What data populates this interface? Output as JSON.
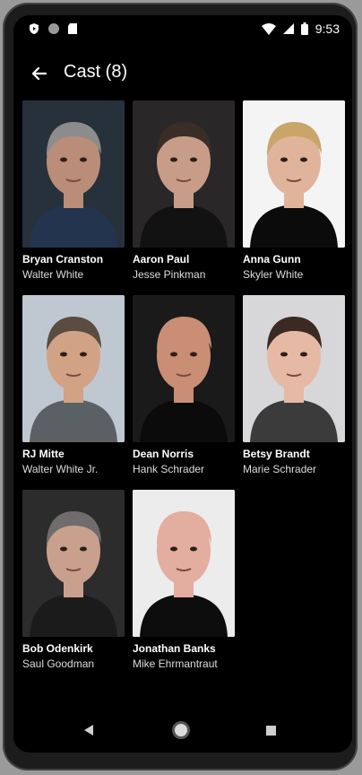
{
  "status": {
    "time": "9:53"
  },
  "appbar": {
    "title": "Cast (8)"
  },
  "cast": [
    {
      "name": "Bryan Cranston",
      "role": "Walter White",
      "bg": "#26313b",
      "skin": "#b98d77",
      "hair": "#8c8c8c",
      "shirt": "#23344f"
    },
    {
      "name": "Aaron Paul",
      "role": "Jesse Pinkman",
      "bg": "#2a2729",
      "skin": "#c79d89",
      "hair": "#3a2d26",
      "shirt": "#121212"
    },
    {
      "name": "Anna Gunn",
      "role": "Skyler White",
      "bg": "#f4f4f4",
      "skin": "#e0b49b",
      "hair": "#c9a56a",
      "shirt": "#0b0b0b"
    },
    {
      "name": "RJ Mitte",
      "role": "Walter White Jr.",
      "bg": "#bfc8d1",
      "skin": "#d2a285",
      "hair": "#5a4c40",
      "shirt": "#5b6065"
    },
    {
      "name": "Dean Norris",
      "role": "Hank Schrader",
      "bg": "#1a1a1a",
      "skin": "#c98e74",
      "hair": "#c98e74",
      "shirt": "#0b0b0b"
    },
    {
      "name": "Betsy Brandt",
      "role": "Marie Schrader",
      "bg": "#d7d7da",
      "skin": "#e6b9a5",
      "hair": "#3b2a22",
      "shirt": "#3b3b3b"
    },
    {
      "name": "Bob Odenkirk",
      "role": "Saul Goodman",
      "bg": "#2c2c2c",
      "skin": "#c9a08e",
      "hair": "#6f6c6b",
      "shirt": "#1b1b1b"
    },
    {
      "name": "Jonathan Banks",
      "role": "Mike Ehrmantraut",
      "bg": "#ececec",
      "skin": "#e3ada0",
      "hair": "#e3ada0",
      "shirt": "#0d0d0d"
    }
  ],
  "icons": {
    "back": "arrow-back-icon",
    "home": "home-icon",
    "recents": "recents-icon"
  }
}
